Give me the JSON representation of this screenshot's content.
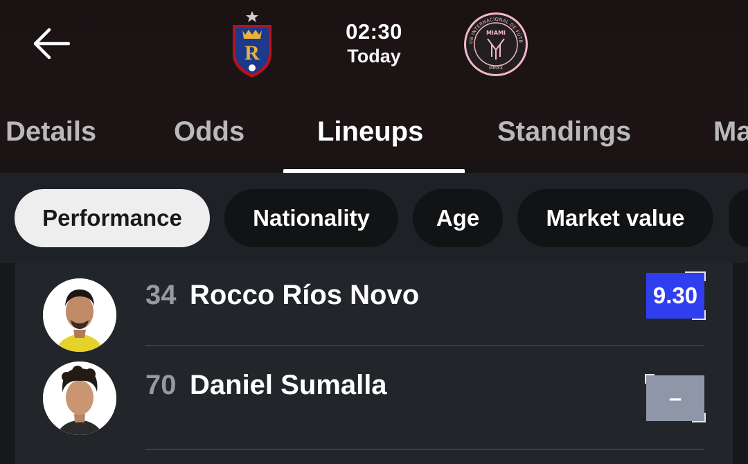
{
  "header": {
    "back_icon": "arrow-left-icon",
    "match_time": "02:30",
    "match_day": "Today",
    "home_team_crest": "real-salt-lake-crest-icon",
    "away_team_crest": "inter-miami-crest-icon",
    "away_crest_text": {
      "top": "CLUB INTERNACIONAL DE FÚTBOL",
      "center": "MIAMI",
      "bottom": "MMXX"
    },
    "home_crest_letter": "R"
  },
  "tabs": [
    {
      "label": "Details"
    },
    {
      "label": "Odds"
    },
    {
      "label": "Lineups",
      "active": true
    },
    {
      "label": "Standings"
    },
    {
      "label": "Ma"
    }
  ],
  "chips": [
    {
      "label": "Performance",
      "active": true
    },
    {
      "label": "Nationality"
    },
    {
      "label": "Age"
    },
    {
      "label": "Market value"
    }
  ],
  "players": [
    {
      "number": "34",
      "name": "Rocco Ríos Novo",
      "rating": "9.30",
      "rating_color": "#2f3ff0"
    },
    {
      "number": "70",
      "name": "Daniel Sumalla",
      "rating": "–",
      "rating_color": "#8f96a8"
    }
  ],
  "colors": {
    "header_bg": "#1d1415",
    "chip_bar_bg": "#1e2226",
    "list_bg": "#22262a",
    "active_chip_bg": "#eeeeee"
  }
}
